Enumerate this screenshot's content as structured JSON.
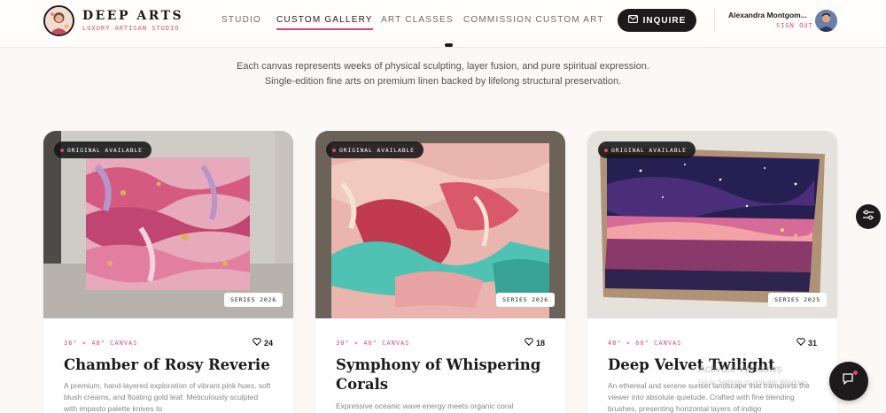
{
  "header": {
    "brand_name": "DEEP ARTS",
    "brand_tagline": "LUXURY ARTISAN STUDIO",
    "nav": [
      {
        "label": "STUDIO",
        "active": false
      },
      {
        "label": "CUSTOM GALLERY",
        "active": true
      },
      {
        "label": "ART CLASSES",
        "active": false
      },
      {
        "label": "COMMISSION CUSTOM ART",
        "active": false
      }
    ],
    "inquire_label": "INQUIRE",
    "user_name": "Alexandra Montgom...",
    "sign_out_label": "SIGN OUT"
  },
  "intro": {
    "line1": "Each canvas represents weeks of physical sculpting, layer fusion, and pure spiritual expression.",
    "line2": "Single-edition fine arts on premium linen backed by lifelong structural preservation."
  },
  "cards": [
    {
      "badge": "ORIGINAL AVAILABLE",
      "series": "SERIES 2026",
      "dimensions": "36\" × 48\" CANVAS",
      "likes": "24",
      "title": "Chamber of Rosy Reverie",
      "description": "A premium, hand-layered exploration of vibrant pink hues, soft blush creams, and floating gold leaf. Meticulously sculpted with impasto palette knives to"
    },
    {
      "badge": "ORIGINAL AVAILABLE",
      "series": "SERIES 2026",
      "dimensions": "30\" × 40\" CANVAS",
      "likes": "18",
      "title": "Symphony of Whispering Corals",
      "description": "Expressive oceanic wave energy meets organic coral"
    },
    {
      "badge": "ORIGINAL AVAILABLE",
      "series": "SERIES 2025",
      "dimensions": "48\" × 60\" CANVAS",
      "likes": "31",
      "title": "Deep Velvet Twilight",
      "description": "An ethereal and serene sunset landscape that transports the viewer into absolute quietude. Crafted with fine blending brushes, presenting horizontal layers of indigo"
    }
  ],
  "watermark": {
    "title": "Activate Windows",
    "subtitle": "Go to Settings to activate Windows."
  },
  "colors": {
    "accent": "#e0457b",
    "dark": "#1d1a1c",
    "background": "#fbf8f6"
  },
  "icons": [
    "logo-portrait",
    "mail-icon",
    "user-avatar",
    "heart-icon",
    "filter-icon",
    "chat-icon"
  ]
}
